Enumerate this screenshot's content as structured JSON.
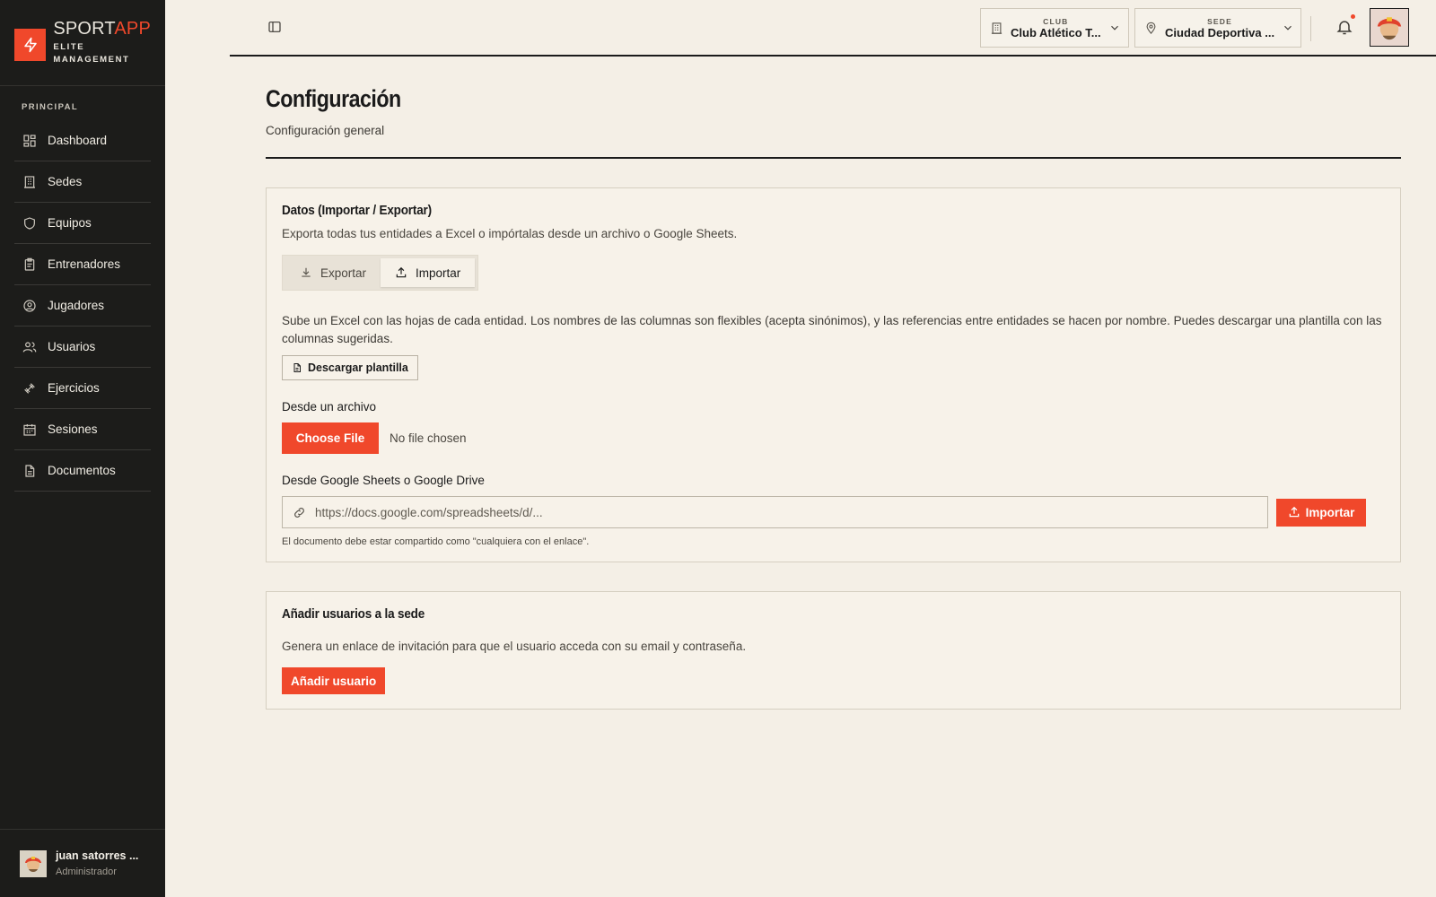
{
  "brand": {
    "name_main": "SPORT",
    "name_accent": "APP",
    "subtitle_line1": "ELITE",
    "subtitle_line2": "MANAGEMENT",
    "accent_color": "#f0482b"
  },
  "sidebar": {
    "section_label": "PRINCIPAL",
    "items": [
      {
        "label": "Dashboard",
        "icon": "dashboard-icon"
      },
      {
        "label": "Sedes",
        "icon": "building-icon"
      },
      {
        "label": "Equipos",
        "icon": "shield-icon"
      },
      {
        "label": "Entrenadores",
        "icon": "clipboard-icon"
      },
      {
        "label": "Jugadores",
        "icon": "user-circle-icon"
      },
      {
        "label": "Usuarios",
        "icon": "users-icon"
      },
      {
        "label": "Ejercicios",
        "icon": "dumbbell-icon"
      },
      {
        "label": "Sesiones",
        "icon": "calendar-icon"
      },
      {
        "label": "Documentos",
        "icon": "document-icon"
      }
    ],
    "user": {
      "name": "juan satorres ...",
      "role": "Administrador"
    }
  },
  "topbar": {
    "club": {
      "label": "CLUB",
      "value": "Club Atlético T..."
    },
    "sede": {
      "label": "SEDE",
      "value": "Ciudad Deportiva ..."
    }
  },
  "page": {
    "title": "Configuración",
    "subtitle": "Configuración general"
  },
  "data_card": {
    "title": "Datos (Importar / Exportar)",
    "description": "Exporta todas tus entidades a Excel o impórtalas desde un archivo o Google Sheets.",
    "tabs": [
      {
        "label": "Exportar",
        "active": false
      },
      {
        "label": "Importar",
        "active": true
      }
    ],
    "import_help": "Sube un Excel con las hojas de cada entidad. Los nombres de las columnas son flexibles (acepta sinónimos), y las referencias entre entidades se hacen por nombre. Puedes descargar una plantilla con las columnas sugeridas.",
    "template_button": "Descargar plantilla",
    "file_label": "Desde un archivo",
    "choose_file": "Choose File",
    "no_file": "No file chosen",
    "sheets_label": "Desde Google Sheets o Google Drive",
    "url_placeholder": "https://docs.google.com/spreadsheets/d/...",
    "import_button": "Importar",
    "hint": "El documento debe estar compartido como \"cualquiera con el enlace\"."
  },
  "users_card": {
    "title": "Añadir usuarios a la sede",
    "description": "Genera un enlace de invitación para que el usuario acceda con su email y contraseña.",
    "button": "Añadir usuario"
  }
}
